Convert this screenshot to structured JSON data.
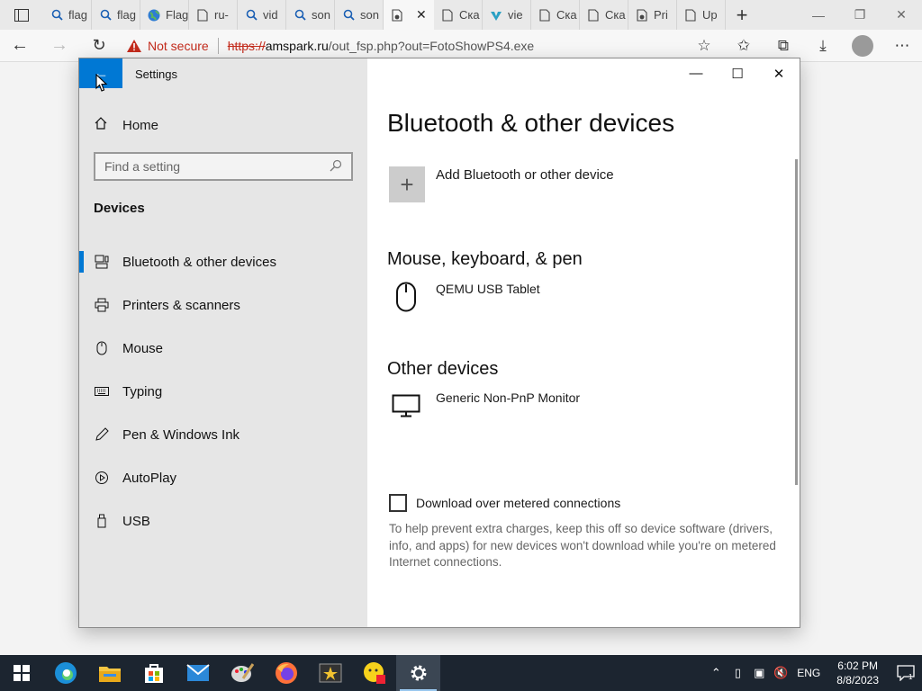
{
  "browser": {
    "tabs": [
      {
        "icon": "search-icon",
        "label": "flag"
      },
      {
        "icon": "search-icon",
        "label": "flag"
      },
      {
        "icon": "globe-icon",
        "label": "Flag"
      },
      {
        "icon": "page-icon",
        "label": "ru-"
      },
      {
        "icon": "search-icon",
        "label": "vid"
      },
      {
        "icon": "search-icon",
        "label": "son"
      },
      {
        "icon": "search-icon",
        "label": "son"
      },
      {
        "icon": "download-page-icon",
        "label": "",
        "active": true
      },
      {
        "icon": "page-icon",
        "label": "Ска"
      },
      {
        "icon": "vk-icon",
        "label": "vie"
      },
      {
        "icon": "page-icon",
        "label": "Ска"
      },
      {
        "icon": "page-icon",
        "label": "Ска"
      },
      {
        "icon": "download-page-icon",
        "label": "Pri"
      },
      {
        "icon": "page-icon",
        "label": "Up"
      }
    ],
    "security_label": "Not secure",
    "url_scheme": "https://",
    "url_host": "amspark.ru",
    "url_path": "/out_fsp.php?out=FotoShowPS4.exe"
  },
  "settings": {
    "window_title": "Settings",
    "home_label": "Home",
    "search_placeholder": "Find a setting",
    "section_label": "Devices",
    "nav": [
      {
        "label": "Bluetooth & other devices",
        "icon": "bluetooth-devices-icon",
        "selected": true
      },
      {
        "label": "Printers & scanners",
        "icon": "printer-icon"
      },
      {
        "label": "Mouse",
        "icon": "mouse-icon"
      },
      {
        "label": "Typing",
        "icon": "keyboard-icon"
      },
      {
        "label": "Pen & Windows Ink",
        "icon": "pen-icon"
      },
      {
        "label": "AutoPlay",
        "icon": "autoplay-icon"
      },
      {
        "label": "USB",
        "icon": "usb-icon"
      }
    ],
    "page_title": "Bluetooth & other devices",
    "add_device_label": "Add Bluetooth or other device",
    "mouse_section": "Mouse, keyboard, & pen",
    "mouse_device": "QEMU USB Tablet",
    "other_section": "Other devices",
    "other_device": "Generic Non-PnP Monitor",
    "metered_label": "Download over metered connections",
    "metered_checked": false,
    "help_text": "To help prevent extra charges, keep this off so device software (drivers, info, and apps) for new devices won't download while you're on metered Internet connections."
  },
  "taskbar": {
    "apps": [
      "edge-icon",
      "file-explorer-icon",
      "store-icon",
      "mail-icon",
      "paint-icon",
      "firefox-icon",
      "movie-maker-icon",
      "emoji-app-icon",
      "settings-gear-icon"
    ],
    "language": "ENG",
    "time": "6:02 PM",
    "date": "8/8/2023",
    "notification_count": "1"
  },
  "colors": {
    "accent": "#0078d4",
    "warning": "#c42b1c",
    "taskbar": "#1c2530"
  }
}
